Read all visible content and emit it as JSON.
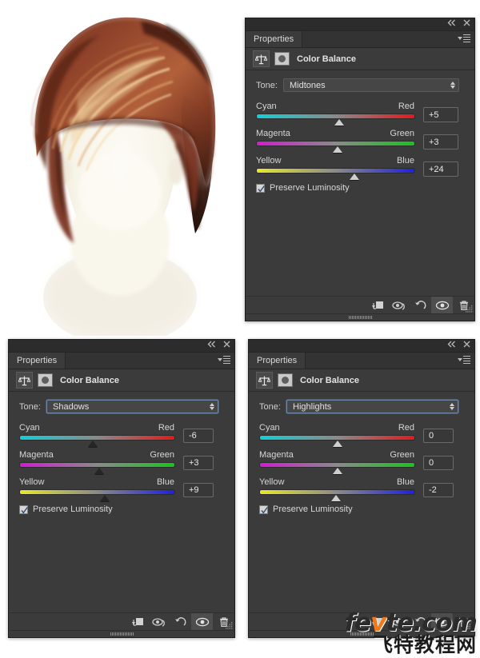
{
  "app": {
    "panel_tab_label": "Properties",
    "adjustment_title": "Color Balance",
    "tone_label": "Tone:",
    "preserve_label": "Preserve Luminosity",
    "labels": {
      "cyan": "Cyan",
      "red": "Red",
      "magenta": "Magenta",
      "green": "Green",
      "yellow": "Yellow",
      "blue": "Blue"
    },
    "icons": {
      "collapse": "collapse-double-arrow-icon",
      "close": "close-icon",
      "panel_menu": "panel-menu-icon",
      "adjustment": "color-balance-scales-icon",
      "mask": "layer-mask-thumbnail-icon",
      "clip": "clip-to-layer-icon",
      "previous_state": "view-previous-state-icon",
      "reset": "reset-adjustment-icon",
      "visibility": "toggle-layer-visibility-icon",
      "delete": "delete-adjustment-layer-icon",
      "resize": "resize-grip-icon"
    },
    "footer_tooltips": {
      "clip": "Clip to layer",
      "previous_state": "View previous state",
      "reset": "Reset to default",
      "visibility": "Toggle layer visibility",
      "delete": "Delete this adjustment layer"
    },
    "colors": {
      "panel_bg": "#3b3b3b",
      "titlebar_bg": "#2c2c2c",
      "tabrow_bg": "#333333",
      "text": "#d4d4d4",
      "focus_border": "#6f87a8",
      "cyan": "#12cfd6",
      "red": "#e01b1b",
      "magenta": "#d41ad4",
      "green": "#17c41d",
      "yellow": "#e8e82a",
      "blue": "#2020dc"
    }
  },
  "panels": [
    {
      "id": "midtones",
      "tone_value": "Midtones",
      "tone_focused": false,
      "preserve_luminosity": true,
      "thumb_style": "light",
      "sliders": [
        {
          "left_label": "Cyan",
          "right_label": "Red",
          "value": "+5",
          "position_pct": 52.5
        },
        {
          "left_label": "Magenta",
          "right_label": "Green",
          "value": "+3",
          "position_pct": 51.5
        },
        {
          "left_label": "Yellow",
          "right_label": "Blue",
          "value": "+24",
          "position_pct": 62.0
        }
      ]
    },
    {
      "id": "shadows",
      "tone_value": "Shadows",
      "tone_focused": true,
      "preserve_luminosity": true,
      "thumb_style": "dark",
      "sliders": [
        {
          "left_label": "Cyan",
          "right_label": "Red",
          "value": "-6",
          "position_pct": 47.0
        },
        {
          "left_label": "Magenta",
          "right_label": "Green",
          "value": "+3",
          "position_pct": 51.5
        },
        {
          "left_label": "Yellow",
          "right_label": "Blue",
          "value": "+9",
          "position_pct": 55.0
        }
      ]
    },
    {
      "id": "highlights",
      "tone_value": "Highlights",
      "tone_focused": true,
      "preserve_luminosity": true,
      "thumb_style": "light",
      "sliders": [
        {
          "left_label": "Cyan",
          "right_label": "Red",
          "value": "0",
          "position_pct": 50.0
        },
        {
          "left_label": "Magenta",
          "right_label": "Green",
          "value": "0",
          "position_pct": 50.0
        },
        {
          "left_label": "Yellow",
          "right_label": "Blue",
          "value": "-2",
          "position_pct": 49.0
        }
      ]
    }
  ],
  "artwork": {
    "description": "Digital painting of a head with auburn red-brown hair and a blank unpainted face"
  },
  "watermark": {
    "line1_a": "fe",
    "line1_b": "v",
    "line1_c": "te.com",
    "line2": "飞特教程网"
  }
}
